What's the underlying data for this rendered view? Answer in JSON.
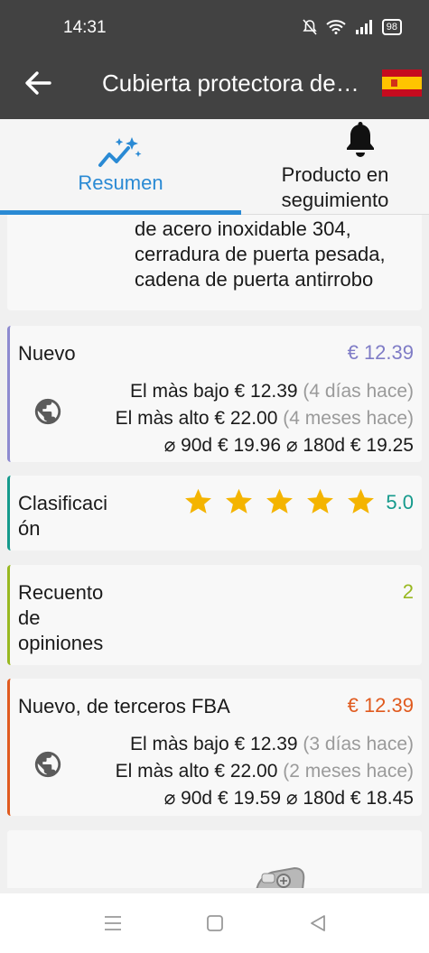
{
  "status_bar": {
    "time": "14:31",
    "battery": "98"
  },
  "app_bar": {
    "title": "Cubierta protectora de…"
  },
  "tabs": [
    {
      "label": "Resumen",
      "active": true
    },
    {
      "label": "Producto en seguimiento",
      "active": false
    }
  ],
  "description": {
    "lines": [
      "de acero inoxidable 304,",
      "cerradura de puerta pesada,",
      "cadena de puerta antirrobo"
    ]
  },
  "nuevo": {
    "label": "Nuevo",
    "price": "€ 12.39",
    "lowest_label": "El màs bajo",
    "lowest_value": "€ 12.39",
    "lowest_when": "(4 días hace)",
    "highest_label": "El màs alto",
    "highest_value": "€ 22.00",
    "highest_when": "(4 meses hace)",
    "avg90_label": "⌀ 90d",
    "avg90_value": "€ 19.96",
    "avg180_label": "⌀ 180d",
    "avg180_value": "€ 19.25"
  },
  "rating": {
    "label_line1": "Clasificaci",
    "label_line2": "ón",
    "value": "5.0",
    "stars": 5
  },
  "reviews": {
    "label_line1": "Recuento",
    "label_line2": "de",
    "label_line3": "opiniones",
    "value": "2"
  },
  "fba": {
    "label": "Nuevo, de terceros FBA",
    "price": "€ 12.39",
    "lowest_label": "El màs bajo",
    "lowest_value": "€ 12.39",
    "lowest_when": "(3 días hace)",
    "highest_label": "El màs alto",
    "highest_value": "€ 22.00",
    "highest_when": "(2 meses hace)",
    "avg90_label": "⌀ 90d",
    "avg90_value": "€ 19.59",
    "avg180_label": "⌀ 180d",
    "avg180_value": "€ 18.45"
  },
  "colors": {
    "accent": "#2a8ad4",
    "nuevo": "#8d8ad0",
    "rating": "#159a8c",
    "reviews": "#98b820",
    "fba": "#e05a1e",
    "star": "#f4b400"
  },
  "icons": [
    "back-arrow-icon",
    "spain-flag-icon",
    "trend-sparkle-icon",
    "bell-icon",
    "globe-icon",
    "star-icon",
    "menu-icon",
    "home-square-icon",
    "back-triangle-icon"
  ]
}
